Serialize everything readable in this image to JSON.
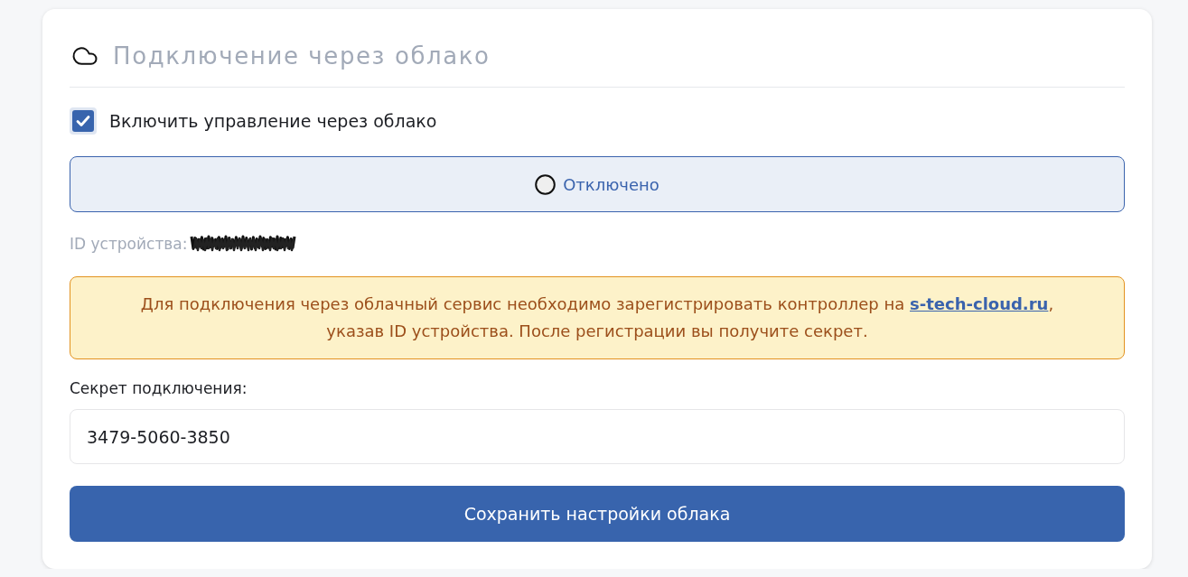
{
  "card": {
    "title": "Подключение через облако"
  },
  "cloud_control": {
    "label": "Включить управление через облако",
    "checked": true
  },
  "status": {
    "label": "Отключено",
    "connected": false
  },
  "device_id": {
    "label": "ID устройства:",
    "value_redacted": true
  },
  "notice": {
    "text_before": "Для подключения через облачный сервис необходимо зарегистрировать контроллер на ",
    "link": "s-tech-cloud.ru",
    "text_after": ", указав ID устройства. После регистрации вы получите секрет."
  },
  "secret": {
    "label": "Секрет подключения:",
    "value": "3479-5060-3850"
  },
  "save_button": {
    "label": "Сохранить настройки облака"
  }
}
